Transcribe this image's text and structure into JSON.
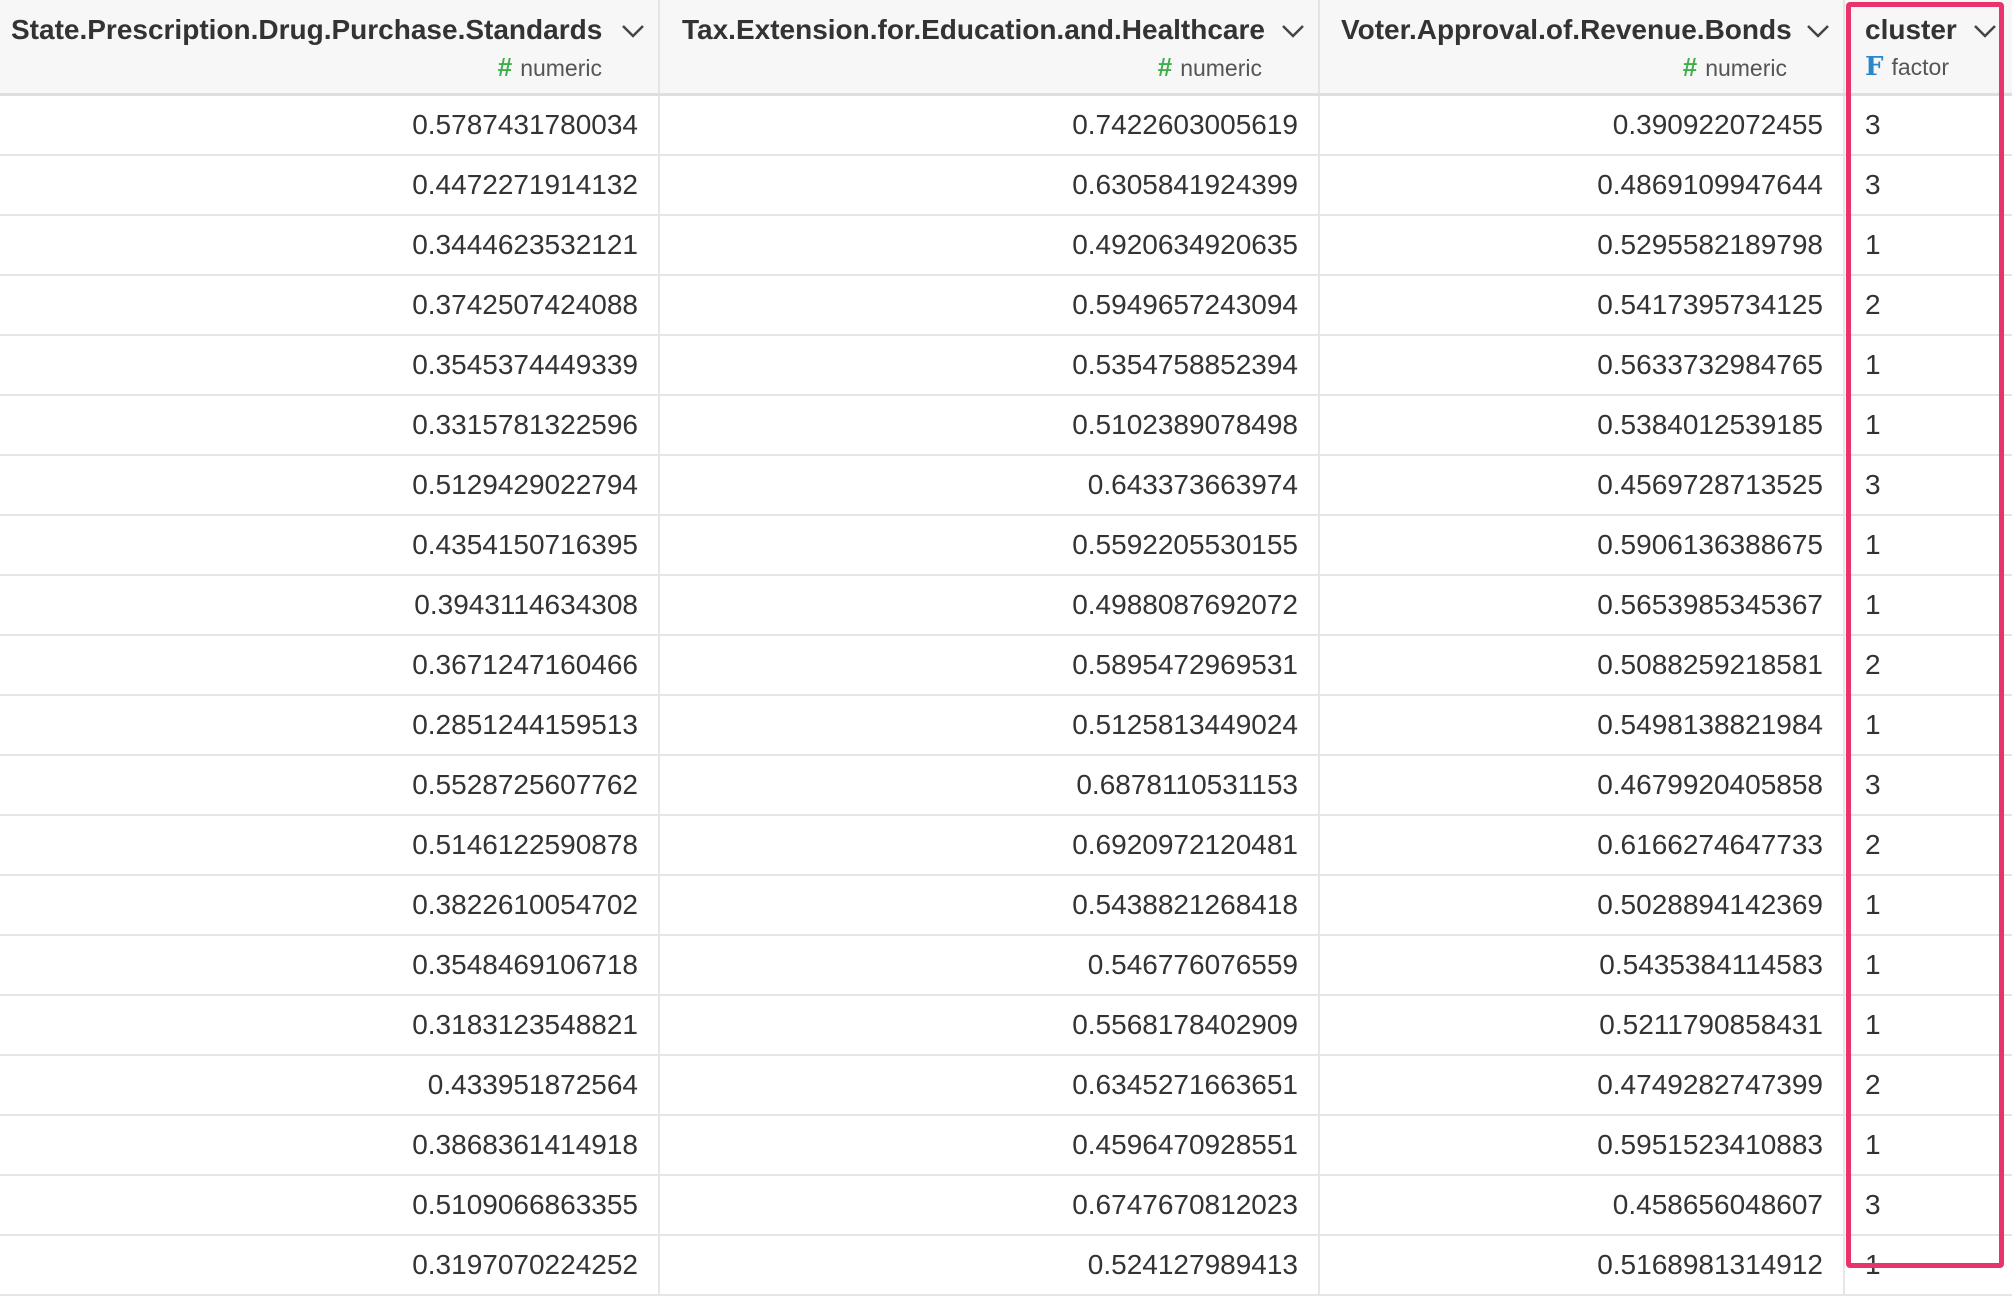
{
  "columns": [
    {
      "name": "State.Prescription.Drug.Purchase.Standards",
      "type": "numeric",
      "type_icon": "hash-icon"
    },
    {
      "name": "Tax.Extension.for.Education.and.Healthcare",
      "type": "numeric",
      "type_icon": "hash-icon"
    },
    {
      "name": "Voter.Approval.of.Revenue.Bonds",
      "type": "numeric",
      "type_icon": "hash-icon"
    },
    {
      "name": "cluster",
      "type": "factor",
      "type_icon": "factor-icon"
    }
  ],
  "type_icons": {
    "numeric": "#",
    "factor": "F"
  },
  "rows": [
    [
      "0.5787431780034",
      "0.7422603005619",
      "0.390922072455",
      "3"
    ],
    [
      "0.4472271914132",
      "0.6305841924399",
      "0.4869109947644",
      "3"
    ],
    [
      "0.3444623532121",
      "0.4920634920635",
      "0.5295582189798",
      "1"
    ],
    [
      "0.3742507424088",
      "0.5949657243094",
      "0.5417395734125",
      "2"
    ],
    [
      "0.3545374449339",
      "0.5354758852394",
      "0.5633732984765",
      "1"
    ],
    [
      "0.3315781322596",
      "0.5102389078498",
      "0.5384012539185",
      "1"
    ],
    [
      "0.5129429022794",
      "0.643373663974",
      "0.4569728713525",
      "3"
    ],
    [
      "0.4354150716395",
      "0.5592205530155",
      "0.5906136388675",
      "1"
    ],
    [
      "0.3943114634308",
      "0.4988087692072",
      "0.5653985345367",
      "1"
    ],
    [
      "0.3671247160466",
      "0.5895472969531",
      "0.5088259218581",
      "2"
    ],
    [
      "0.2851244159513",
      "0.5125813449024",
      "0.5498138821984",
      "1"
    ],
    [
      "0.5528725607762",
      "0.6878110531153",
      "0.4679920405858",
      "3"
    ],
    [
      "0.5146122590878",
      "0.6920972120481",
      "0.6166274647733",
      "2"
    ],
    [
      "0.3822610054702",
      "0.5438821268418",
      "0.5028894142369",
      "1"
    ],
    [
      "0.3548469106718",
      "0.546776076559",
      "0.5435384114583",
      "1"
    ],
    [
      "0.3183123548821",
      "0.5568178402909",
      "0.5211790858431",
      "1"
    ],
    [
      "0.433951872564",
      "0.6345271663651",
      "0.4749282747399",
      "2"
    ],
    [
      "0.3868361414918",
      "0.4596470928551",
      "0.5951523410883",
      "1"
    ],
    [
      "0.5109066863355",
      "0.6747670812023",
      "0.458656048607",
      "3"
    ],
    [
      "0.3197070224252",
      "0.524127989413",
      "0.5168981314912",
      "1"
    ]
  ],
  "colors": {
    "highlight": "#e8336d",
    "numeric_icon": "#3fae4a",
    "factor_icon": "#2d86c8"
  }
}
